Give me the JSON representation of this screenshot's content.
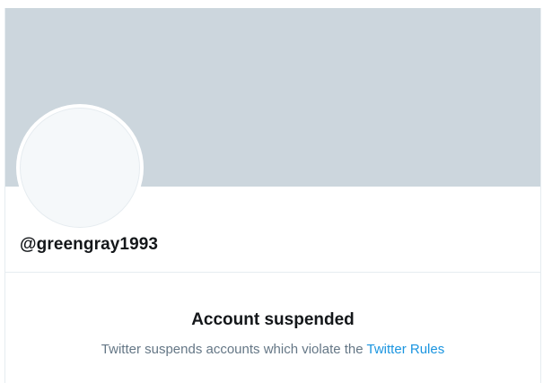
{
  "profile": {
    "handle": "@greengray1993"
  },
  "notice": {
    "title": "Account suspended",
    "body_text": "Twitter suspends accounts which violate the",
    "link_label": "Twitter Rules"
  },
  "colors": {
    "banner": "#ccd6dd",
    "avatar_fill": "#f5f8fa",
    "link": "#1b95e0",
    "secondary_text": "#657786",
    "primary_text": "#14171a"
  }
}
